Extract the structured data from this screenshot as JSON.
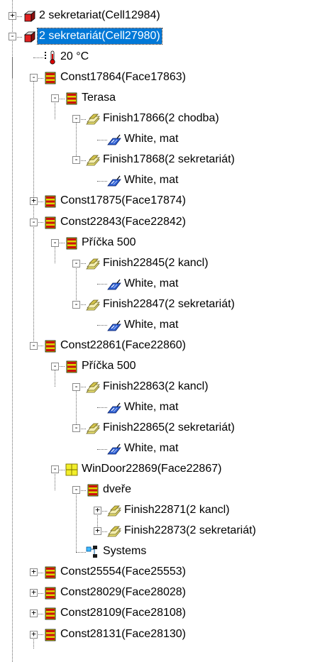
{
  "colors": {
    "selection": "#0078d7",
    "connector": "#6a6a6a"
  },
  "tree": [
    {
      "label": "2 sekretariat(Cell12984)",
      "icon": "cell-box-icon",
      "expander": "+"
    },
    {
      "label": "2 sekretariát(Cell27980)",
      "icon": "cell-box-icon",
      "expander": "-",
      "selected": true
    },
    {
      "label": "20 °C",
      "icon": "thermometer-icon"
    },
    {
      "label": "Const17864(Face17863)",
      "icon": "construction-icon",
      "expander": "-"
    },
    {
      "label": "Terasa",
      "icon": "construction-icon",
      "expander": "-"
    },
    {
      "label": "Finish17866(2 chodba)",
      "icon": "finish-layer-icon",
      "expander": "-"
    },
    {
      "label": "White, mat",
      "icon": "material-icon"
    },
    {
      "label": "Finish17868(2 sekretariát)",
      "icon": "finish-layer-icon",
      "expander": "-"
    },
    {
      "label": "White, mat",
      "icon": "material-icon"
    },
    {
      "label": "Const17875(Face17874)",
      "icon": "construction-icon",
      "expander": "+"
    },
    {
      "label": "Const22843(Face22842)",
      "icon": "construction-icon",
      "expander": "-"
    },
    {
      "label": "Příčka 500",
      "icon": "construction-icon",
      "expander": "-"
    },
    {
      "label": "Finish22845(2 kancl)",
      "icon": "finish-layer-icon",
      "expander": "-"
    },
    {
      "label": "White, mat",
      "icon": "material-icon"
    },
    {
      "label": "Finish22847(2 sekretariát)",
      "icon": "finish-layer-icon",
      "expander": "-"
    },
    {
      "label": "White, mat",
      "icon": "material-icon"
    },
    {
      "label": "Const22861(Face22860)",
      "icon": "construction-icon",
      "expander": "-"
    },
    {
      "label": "Příčka 500",
      "icon": "construction-icon",
      "expander": "-"
    },
    {
      "label": "Finish22863(2 kancl)",
      "icon": "finish-layer-icon",
      "expander": "-"
    },
    {
      "label": "White, mat",
      "icon": "material-icon"
    },
    {
      "label": "Finish22865(2 sekretariát)",
      "icon": "finish-layer-icon",
      "expander": "-"
    },
    {
      "label": "White, mat",
      "icon": "material-icon"
    },
    {
      "label": "WinDoor22869(Face22867)",
      "icon": "window-door-icon",
      "expander": "-"
    },
    {
      "label": "dveře",
      "icon": "construction-icon",
      "expander": "-"
    },
    {
      "label": "Finish22871(2 kancl)",
      "icon": "finish-layer-icon",
      "expander": "+"
    },
    {
      "label": "Finish22873(2 sekretariát)",
      "icon": "finish-layer-icon",
      "expander": "+"
    },
    {
      "label": "Systems",
      "icon": "systems-icon"
    },
    {
      "label": "Const25554(Face25553)",
      "icon": "construction-icon",
      "expander": "+"
    },
    {
      "label": "Const28029(Face28028)",
      "icon": "construction-icon",
      "expander": "+"
    },
    {
      "label": "Const28109(Face28108)",
      "icon": "construction-icon",
      "expander": "+"
    },
    {
      "label": "Const28131(Face28130)",
      "icon": "construction-icon",
      "expander": "+"
    }
  ]
}
